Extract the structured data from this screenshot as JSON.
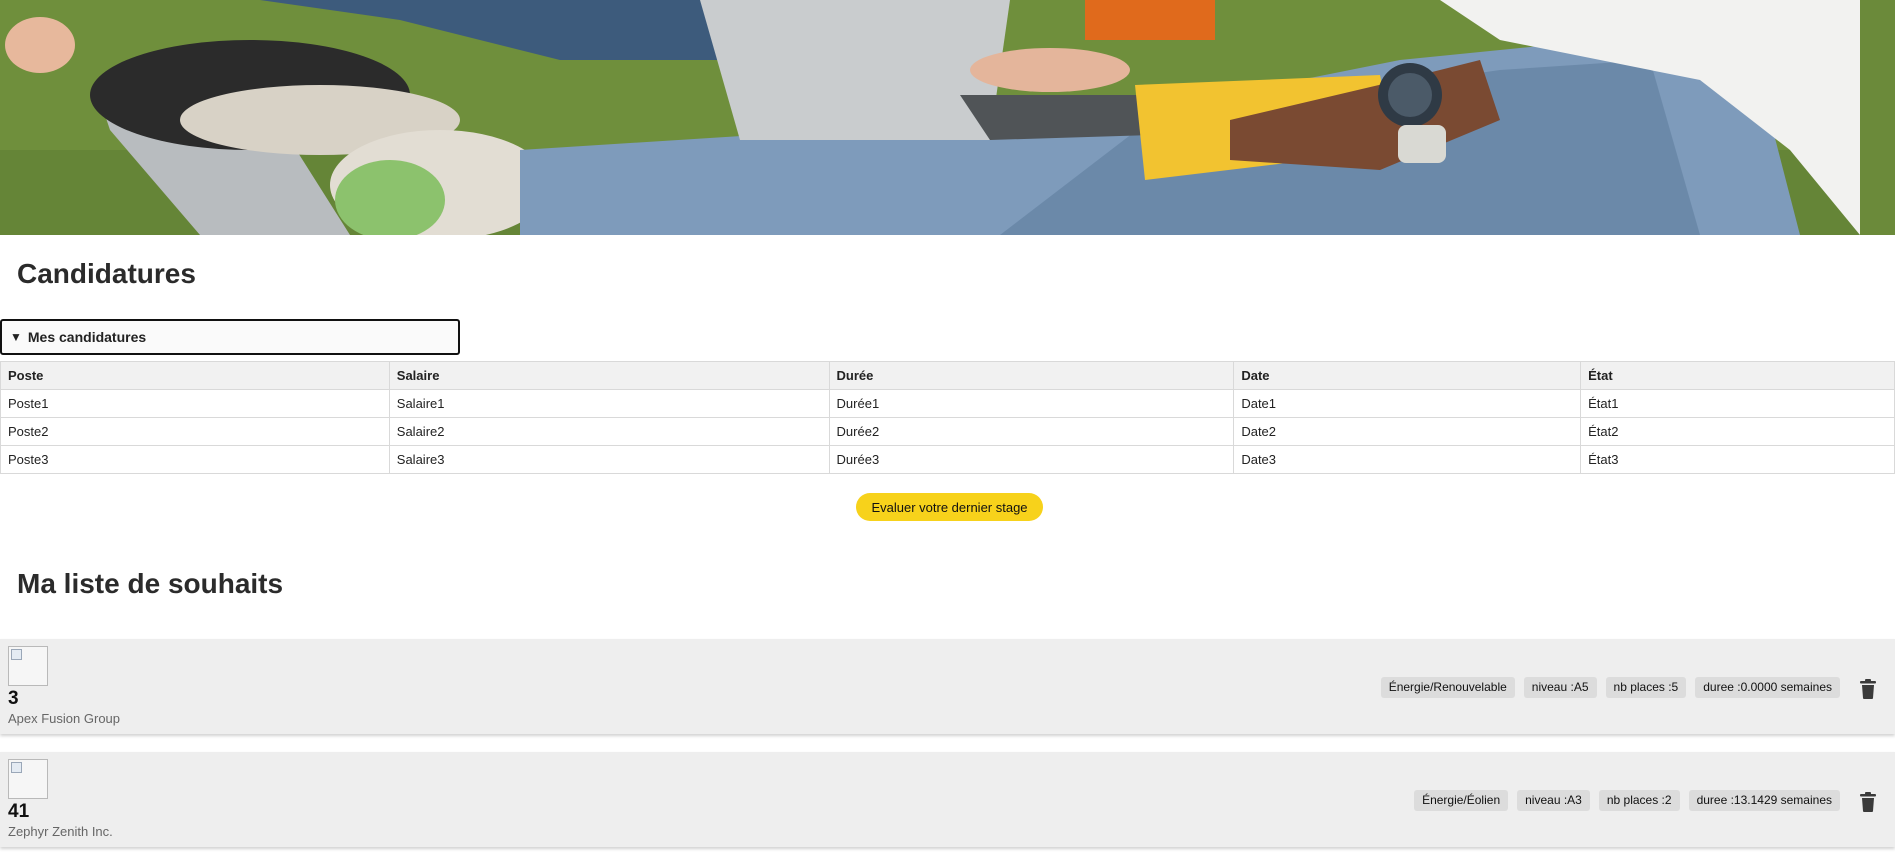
{
  "hero": {
    "alt": ""
  },
  "applications": {
    "title": "Candidatures",
    "summary_label": "Mes candidatures",
    "caret": "▼",
    "columns": [
      "Poste",
      "Salaire",
      "Durée",
      "Date",
      "État"
    ],
    "rows": [
      [
        "Poste1",
        "Salaire1",
        "Durée1",
        "Date1",
        "État1"
      ],
      [
        "Poste2",
        "Salaire2",
        "Durée2",
        "Date2",
        "État2"
      ],
      [
        "Poste3",
        "Salaire3",
        "Durée3",
        "Date3",
        "État3"
      ]
    ],
    "evaluate_label": "Evaluer votre dernier stage"
  },
  "wishlist": {
    "title": "Ma liste de souhaits",
    "items": [
      {
        "number": "3",
        "company": "Apex Fusion Group",
        "tags": [
          "Énergie/Renouvelable",
          "niveau :A5",
          "nb places :5",
          "duree :0.0000 semaines"
        ]
      },
      {
        "number": "41",
        "company": "Zephyr Zenith Inc.",
        "tags": [
          "Énergie/Éolien",
          "niveau :A3",
          "nb places :2",
          "duree :13.1429 semaines"
        ]
      }
    ]
  },
  "colors": {
    "accent_button": "#f7d21b",
    "card_background": "#eeeeee",
    "tag_background": "#dcdcdc"
  },
  "icons": {
    "delete": "trash-icon",
    "image_placeholder": "broken-image-icon"
  }
}
